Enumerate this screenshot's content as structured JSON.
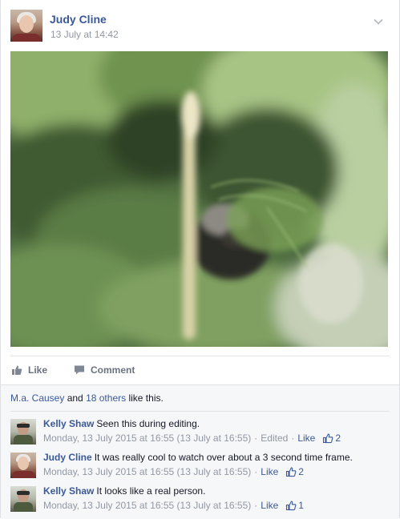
{
  "post": {
    "author": "Judy Cline",
    "timestamp": "13 July at 14:42"
  },
  "actions": {
    "like_label": "Like",
    "comment_label": "Comment"
  },
  "likes": {
    "first_liker": "M.a. Causey",
    "and_text": "and",
    "others_link": "18 others",
    "suffix": "like this."
  },
  "comments": [
    {
      "author": "Kelly Shaw",
      "text": "Seen this during editing.",
      "time": "Monday, 13 July 2015 at 16:55 (13 July at 16:55)",
      "edited": "Edited",
      "like_label": "Like",
      "like_count": "2"
    },
    {
      "author": "Judy Cline",
      "text": "It was really cool to watch over about a 3 second time frame.",
      "time": "Monday, 13 July 2015 at 16:55 (13 July at 16:55)",
      "like_label": "Like",
      "like_count": "2"
    },
    {
      "author": "Kelly Shaw",
      "text": "It looks like a real person.",
      "time": "Monday, 13 July 2015 at 16:55 (13 July at 16:55)",
      "like_label": "Like",
      "like_count": "1"
    }
  ],
  "meta_separator": "·",
  "icons": {
    "chevron": "chevron-down-icon",
    "like": "thumbs-up-icon",
    "comment": "speech-bubble-icon"
  },
  "colors": {
    "link": "#3b5998",
    "muted": "#9197a3",
    "feedback_bg": "#f6f7f9"
  }
}
